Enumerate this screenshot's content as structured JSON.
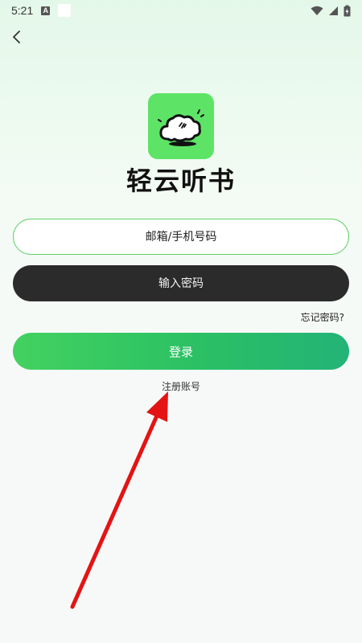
{
  "status_bar": {
    "time": "5:21",
    "notification_letter": "A"
  },
  "app": {
    "name": "轻云听书"
  },
  "form": {
    "email_placeholder": "邮箱/手机号码",
    "password_placeholder": "输入密码",
    "forgot_label": "忘记密码?",
    "login_label": "登录",
    "register_label": "注册账号"
  },
  "icons": {
    "back": "chevron-left-icon",
    "logo": "cloud-logo-icon",
    "wifi": "wifi-icon",
    "signal": "cell-signal-icon",
    "battery": "battery-charging-icon"
  },
  "colors": {
    "accent_green": "#43d260",
    "logo_green": "#5de466",
    "dark_input": "#2b2b2b",
    "arrow_red": "#e41414"
  }
}
